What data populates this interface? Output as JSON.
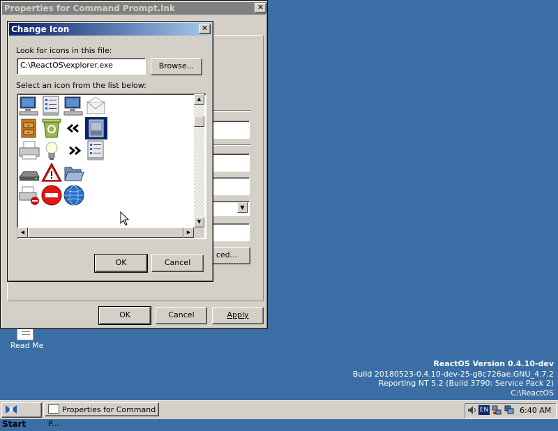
{
  "colors": {
    "desktop": "#3a6ea5",
    "active_title_start": "#0a246a",
    "active_title_end": "#a6caf0",
    "inactive_title": "#808080"
  },
  "props_window": {
    "title": "Properties for Command Prompt.lnk",
    "close_glyph": "✕",
    "partial_button": "ced...",
    "ok": "OK",
    "cancel": "Cancel",
    "apply": "Apply"
  },
  "dialog": {
    "title": "Change Icon",
    "close_glyph": "✕",
    "look_label": "Look for icons in this file:",
    "file_value": "C:\\ReactOS\\explorer.exe",
    "browse": "Browse...",
    "select_label": "Select an icon from the list below:",
    "icons": [
      "computer-icon",
      "server-list-icon",
      "computer-icon",
      "envelope-icon",
      "cabinet-icon",
      "recycle-bin-icon",
      "double-left-arrow-icon",
      "printer-folder-icon",
      "printer-icon",
      "lightbulb-icon",
      "double-right-arrow-icon",
      "server-list-icon",
      "drive-icon",
      "warning-icon",
      "open-folder-icon",
      "printer-error-icon",
      "stop-icon",
      "globe-icon"
    ],
    "ok": "OK",
    "cancel": "Cancel"
  },
  "desktop": {
    "icon_label": "Read Me"
  },
  "version": {
    "line1": "ReactOS Version 0.4.10-dev",
    "line2": "Build 20180523-0.4.10-dev-25-g8c726ae.GNU_4.7.2",
    "line3": "Reporting NT 5.2 (Build 3790: Service Pack 2)",
    "line4": "C:\\ReactOS"
  },
  "taskbar": {
    "start": "Start",
    "task": "Properties for Command P...",
    "lang": "EN",
    "time": "6:40 AM"
  }
}
